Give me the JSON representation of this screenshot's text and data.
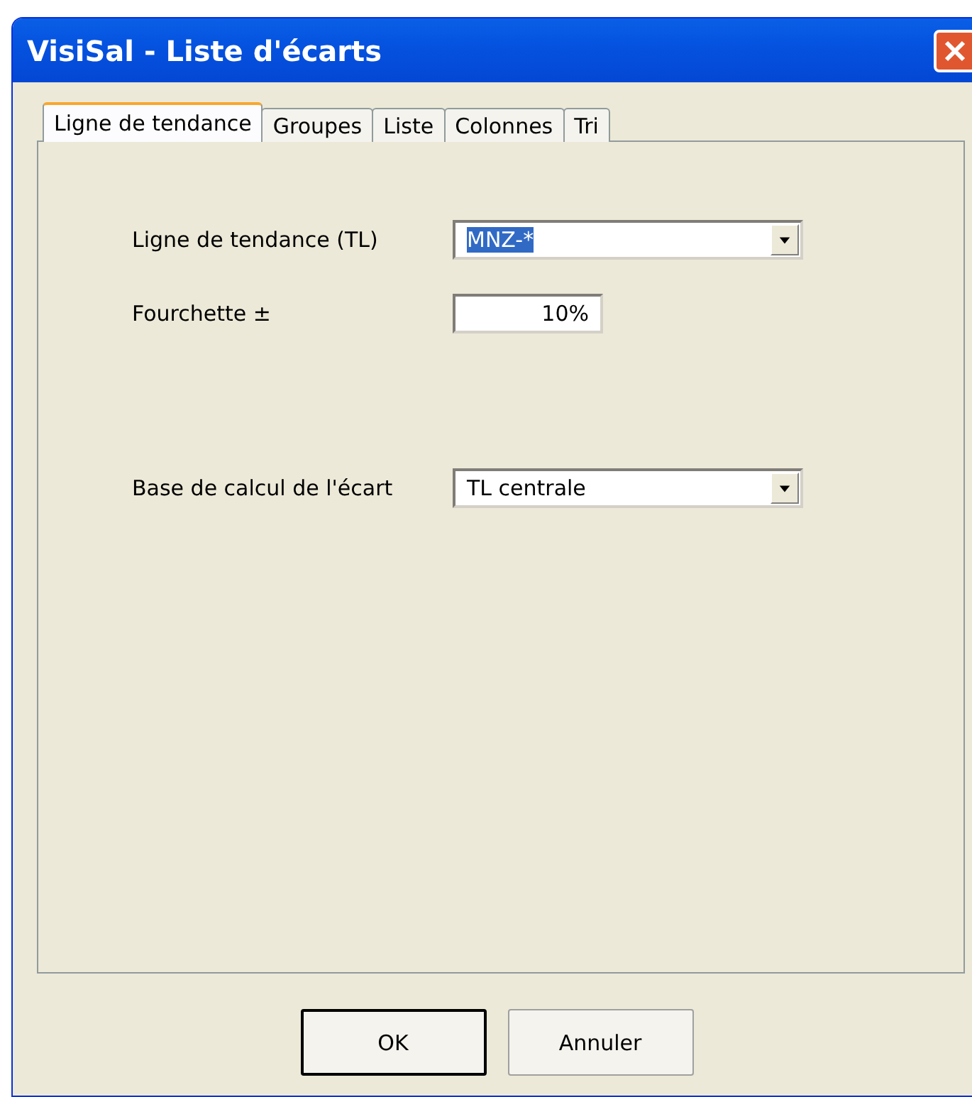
{
  "window": {
    "title": "VisiSal - Liste d'écarts"
  },
  "tabs": [
    {
      "label": "Ligne de tendance",
      "selected": true
    },
    {
      "label": "Groupes",
      "selected": false
    },
    {
      "label": "Liste",
      "selected": false
    },
    {
      "label": "Colonnes",
      "selected": false
    },
    {
      "label": "Tri",
      "selected": false
    }
  ],
  "fields": [
    {
      "kind": "combo",
      "label": "Ligne de tendance (TL)",
      "value": "MNZ-*",
      "highlighted": true
    },
    {
      "kind": "text",
      "label": "Fourchette ±",
      "value": "10%",
      "highlighted": false
    },
    {
      "kind": "spacer"
    },
    {
      "kind": "combo",
      "label": "Base de calcul de l'écart",
      "value": "TL centrale",
      "highlighted": false
    }
  ],
  "buttons": [
    {
      "label": "OK",
      "default": true
    },
    {
      "label": "Annuler",
      "default": false
    }
  ]
}
